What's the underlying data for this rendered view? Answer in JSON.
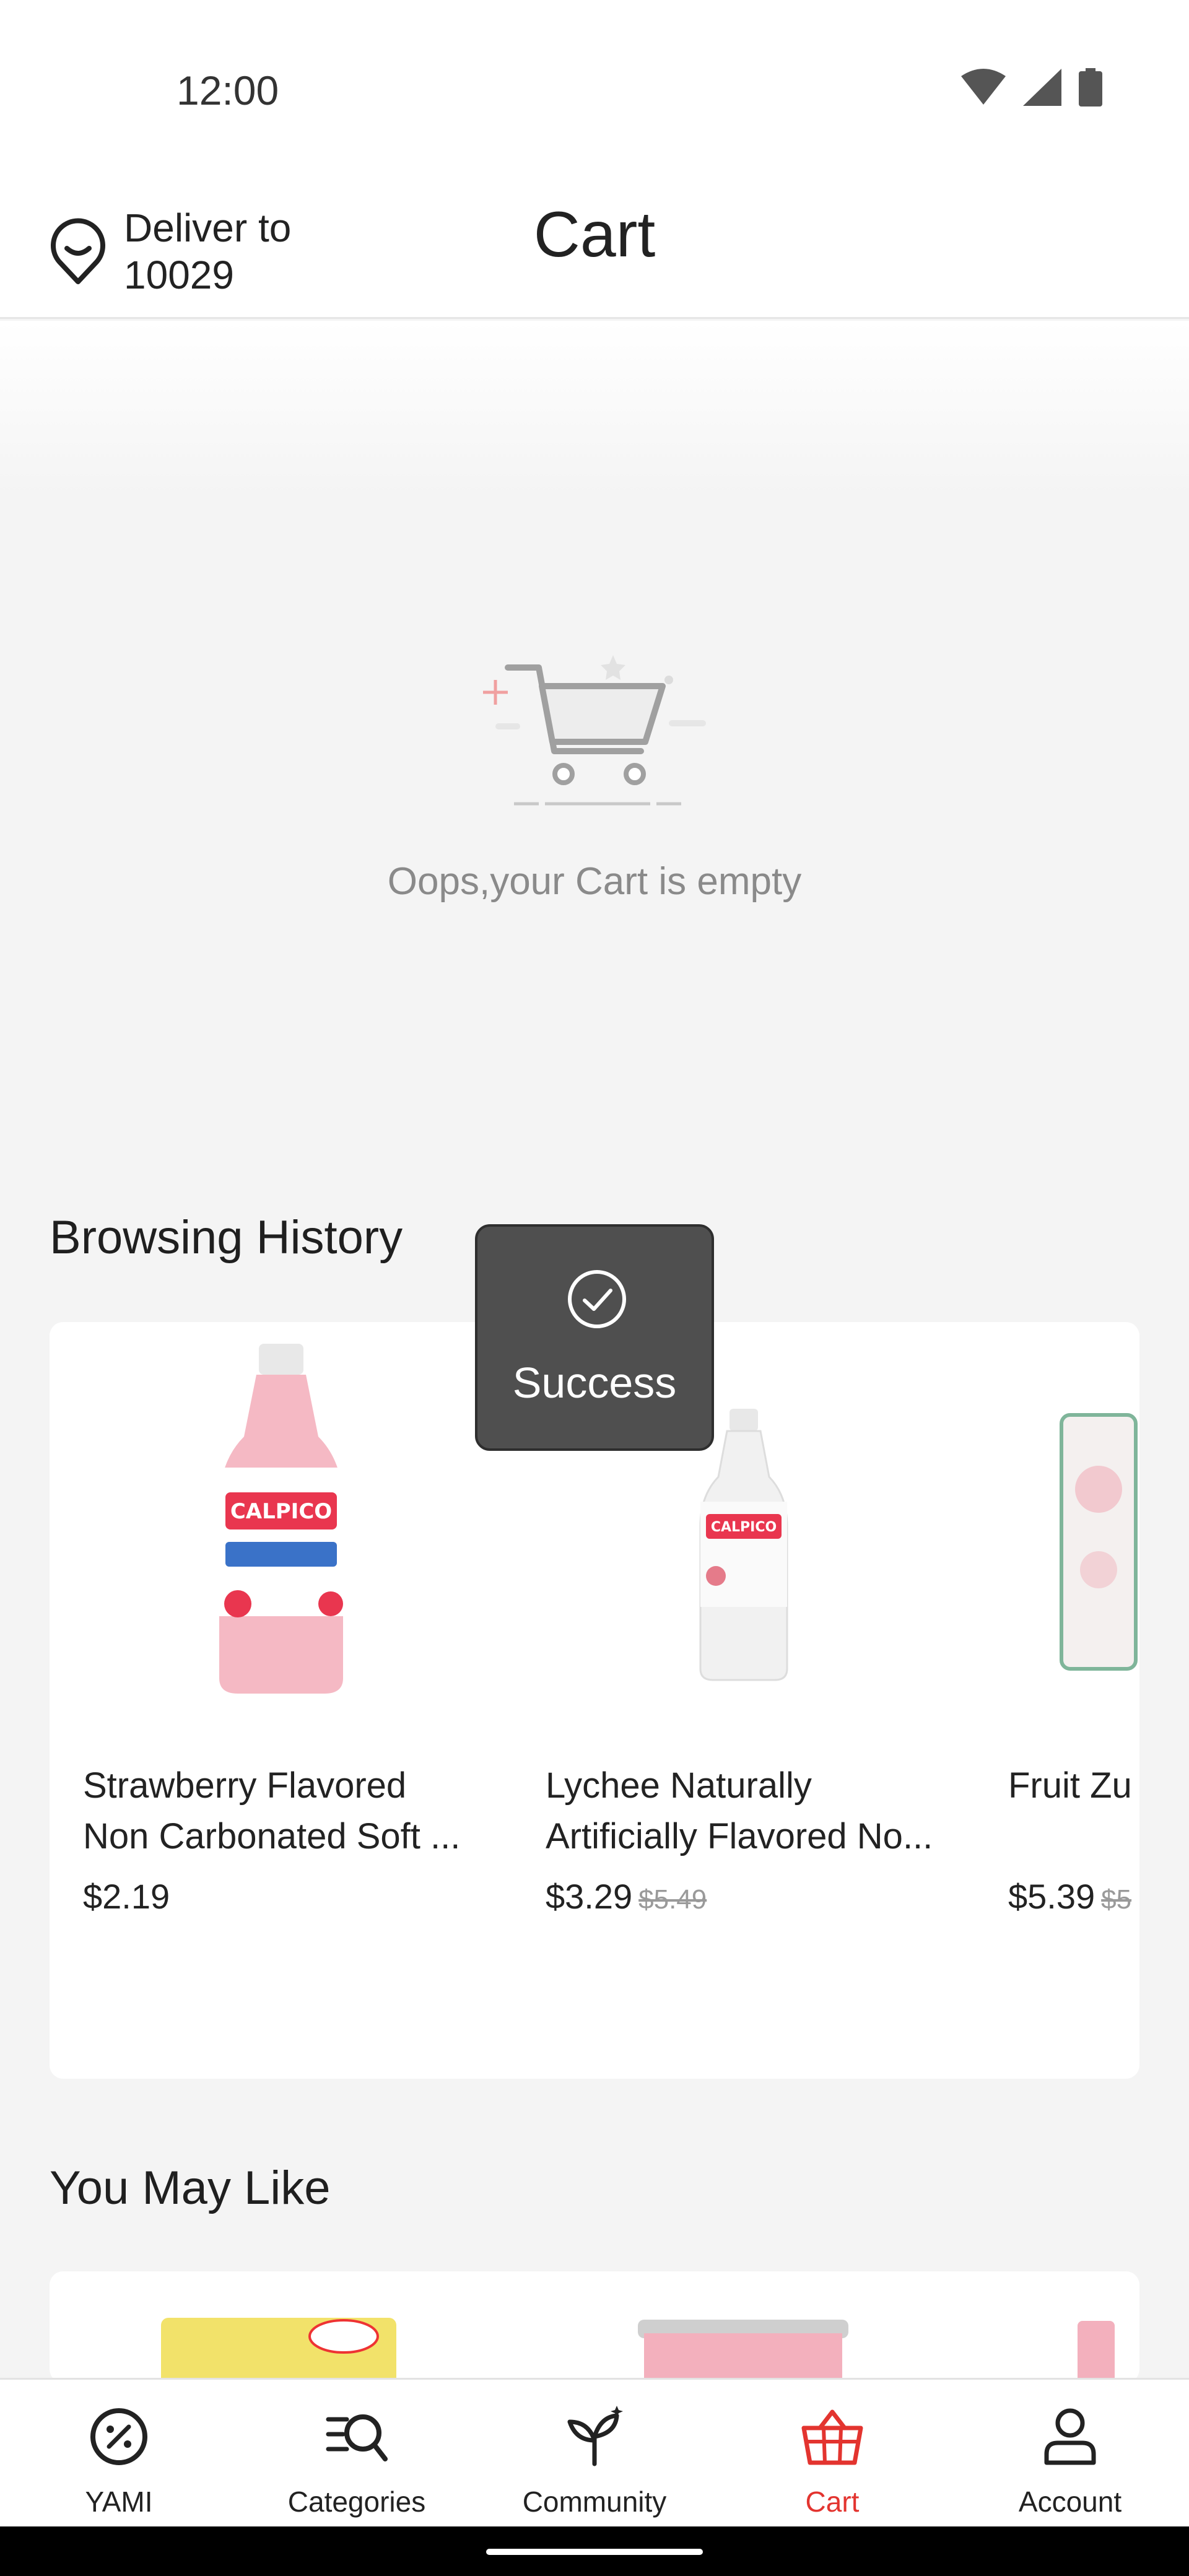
{
  "status_bar": {
    "time": "12:00"
  },
  "header": {
    "deliver_label": "Deliver to",
    "zip": "10029",
    "title": "Cart"
  },
  "empty_cart": {
    "message": "Oops,your Cart is empty"
  },
  "toast": {
    "text": "Success"
  },
  "browsing_history": {
    "title": "Browsing History",
    "items": [
      {
        "name": "Strawberry Flavored Non Carbonated Soft ...",
        "price": "$2.19",
        "old_price": ""
      },
      {
        "name": "Lychee Naturally Artificially Flavored No...",
        "price": "$3.29",
        "old_price": "$5.49"
      },
      {
        "name": "Fruit Zu Frugra C",
        "price": "$5.39",
        "old_price": "$5"
      }
    ]
  },
  "you_may_like": {
    "title": "You May Like"
  },
  "bottom_nav": {
    "items": [
      {
        "label": "YAMI",
        "icon": "discount-icon"
      },
      {
        "label": "Categories",
        "icon": "categories-search-icon"
      },
      {
        "label": "Community",
        "icon": "sprout-icon"
      },
      {
        "label": "Cart",
        "icon": "basket-icon"
      },
      {
        "label": "Account",
        "icon": "person-icon"
      }
    ],
    "active_index": 3
  },
  "colors": {
    "accent": "#e3342f",
    "toast_bg": "#4f4f4f"
  }
}
